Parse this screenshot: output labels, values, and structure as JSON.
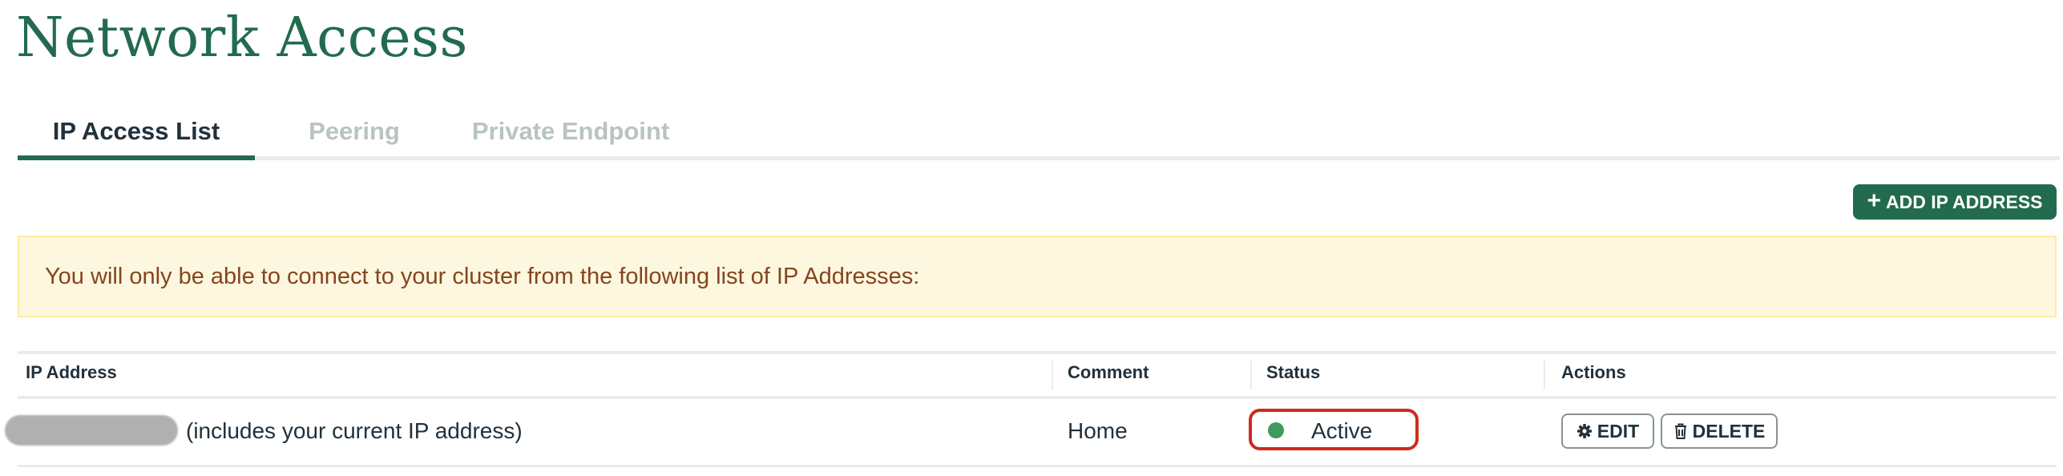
{
  "page": {
    "title": "Network Access"
  },
  "tabs": [
    {
      "label": "IP Access List",
      "active": true
    },
    {
      "label": "Peering",
      "active": false
    },
    {
      "label": "Private Endpoint",
      "active": false
    }
  ],
  "add_button": {
    "label": "ADD IP ADDRESS",
    "icon": "plus-icon"
  },
  "banner": {
    "text": "You will only be able to connect to your cluster from the following list of IP Addresses:"
  },
  "table": {
    "columns": [
      "IP Address",
      "Comment",
      "Status",
      "Actions"
    ],
    "rows": [
      {
        "ip_note": "(includes your current IP address)",
        "comment": "Home",
        "status": "Active",
        "status_color": "#3e9a5e",
        "actions": {
          "edit": "EDIT",
          "delete": "DELETE"
        }
      }
    ]
  },
  "colors": {
    "brand": "#226b4e",
    "banner_bg": "#fef7e0",
    "banner_text": "#86451c",
    "highlight": "#cf2a1e"
  }
}
